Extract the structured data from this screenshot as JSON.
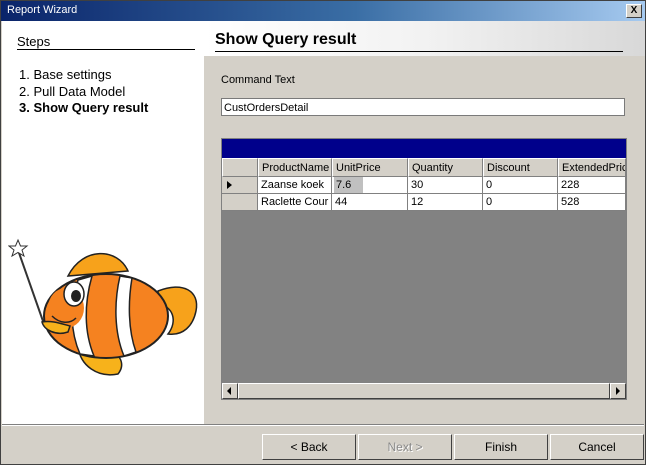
{
  "window": {
    "title": "Report Wizard",
    "close_label": "X"
  },
  "steps": {
    "title": "Steps",
    "items": [
      {
        "label": "1. Base settings",
        "active": false
      },
      {
        "label": "2. Pull Data Model",
        "active": false
      },
      {
        "label": "3. Show Query result",
        "active": true
      }
    ]
  },
  "page": {
    "title": "Show Query result"
  },
  "command": {
    "label": "Command Text",
    "value": "CustOrdersDetail"
  },
  "grid": {
    "columns": [
      "ProductName",
      "UnitPrice",
      "Quantity",
      "Discount",
      "ExtendedPric"
    ],
    "rows": [
      [
        "Zaanse koek",
        "7.6",
        "30",
        "0",
        "228"
      ],
      [
        "Raclette Cour",
        "44",
        "12",
        "0",
        "528"
      ]
    ],
    "current_row": 0
  },
  "buttons": {
    "back": "< Back",
    "next": "Next >",
    "finish": "Finish",
    "cancel": "Cancel"
  },
  "icons": {
    "close": "close-icon",
    "row-indicator": "row-indicator-icon",
    "mascot": "clownfish-wand-illustration"
  },
  "colors": {
    "grid_caption": "#00008b",
    "title_start": "#0a246a",
    "title_end": "#a6caf0"
  }
}
